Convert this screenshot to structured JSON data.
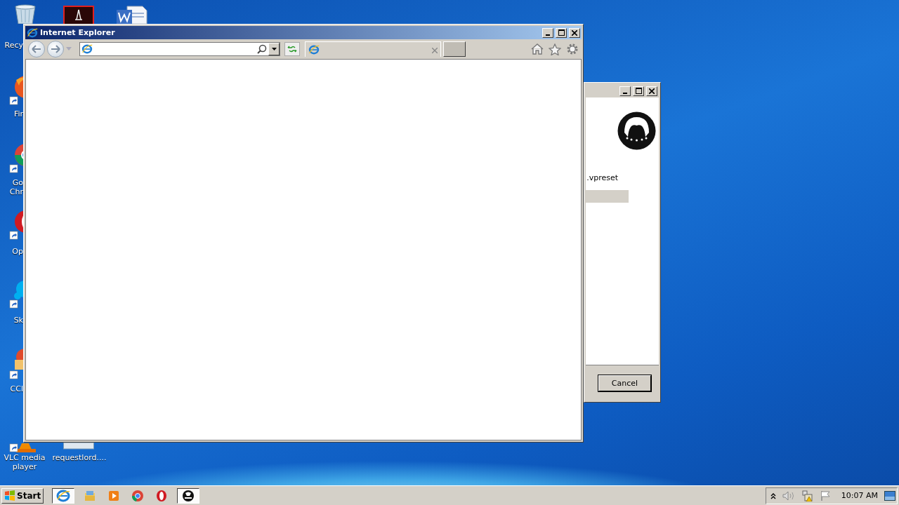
{
  "desktop_icons": [
    {
      "kind": "recycle",
      "lines": [
        "Recy"
      ]
    },
    {
      "kind": "acrobat"
    },
    {
      "kind": "word"
    },
    {
      "kind": "firefox",
      "lines": [
        "Fir"
      ]
    },
    {
      "kind": "chrome",
      "lines": [
        "Go",
        "Chr"
      ]
    },
    {
      "kind": "opera",
      "lines": [
        "Op"
      ]
    },
    {
      "kind": "skype",
      "lines": [
        "Sk"
      ]
    },
    {
      "kind": "ccleaner",
      "lines": [
        "CCl"
      ]
    },
    {
      "kind": "vlc",
      "lines": [
        "VLC media",
        "player"
      ]
    },
    {
      "kind": "file",
      "lines": [
        "requestlord...."
      ]
    }
  ],
  "dialog": {
    "file_text": ".vpreset",
    "buttons": [
      "Cancel"
    ]
  },
  "browser_window": {
    "title": "Internet Explorer"
  },
  "taskbar": {
    "start": "Start",
    "apps": [
      {
        "kind": "ie",
        "selected": true
      },
      {
        "kind": "explorer",
        "selected": false
      },
      {
        "kind": "media",
        "selected": false
      },
      {
        "kind": "chrome",
        "selected": false
      },
      {
        "kind": "opera",
        "selected": false
      },
      {
        "kind": "app",
        "selected": true
      }
    ],
    "time": "10:07 AM"
  }
}
